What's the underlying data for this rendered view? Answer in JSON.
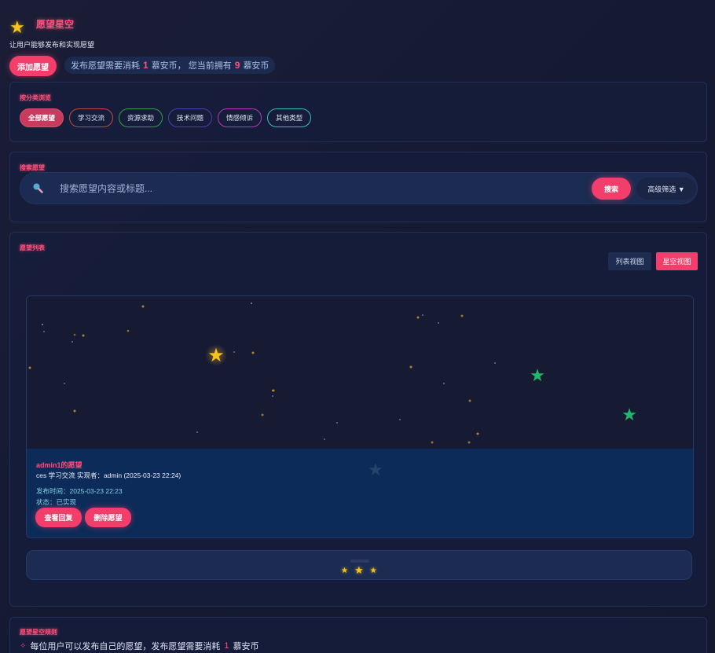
{
  "app": {
    "logo_icon": "star-icon",
    "title": "愿望星空",
    "subtitle": "让用户能够发布和实现愿望"
  },
  "top": {
    "add_button": "添加愿望",
    "coin_prefix": "发布愿望需要消耗",
    "coin_cost": "1",
    "coin_mid": "慕安币， 您当前拥有",
    "coin_balance": "9",
    "coin_suffix": "慕安币"
  },
  "categories": {
    "label": "按分类浏览",
    "items": [
      "全部愿望",
      "学习交流",
      "资源求助",
      "技术问题",
      "情感倾诉",
      "其他类型"
    ]
  },
  "search": {
    "label": "搜索愿望",
    "placeholder": "搜索愿望内容或标题...",
    "button": "搜索",
    "advanced": "高级筛选 ▼"
  },
  "wish_list": {
    "label": "愿望列表",
    "view_list": "列表视图",
    "view_star": "星空视图",
    "card": {
      "title": "admin1的愿望",
      "content": "ces 学习交流 实现者：admin (2025-03-23 22:24)",
      "date": "发布时间：2025-03-23 22:23",
      "status": "状态：已实现",
      "view_reply": "查看回复",
      "delete": "删除愿望"
    }
  },
  "rules": {
    "label": "愿望星空规则",
    "rule1_prefix": "每位用户可以发布自己的愿望，发布愿望需要消耗",
    "rule1_num": "1",
    "rule1_suffix": "慕安币"
  },
  "colors": {
    "accent": "#f33d6b",
    "star_gold": "#f8c41a",
    "star_green": "#22b86a"
  }
}
